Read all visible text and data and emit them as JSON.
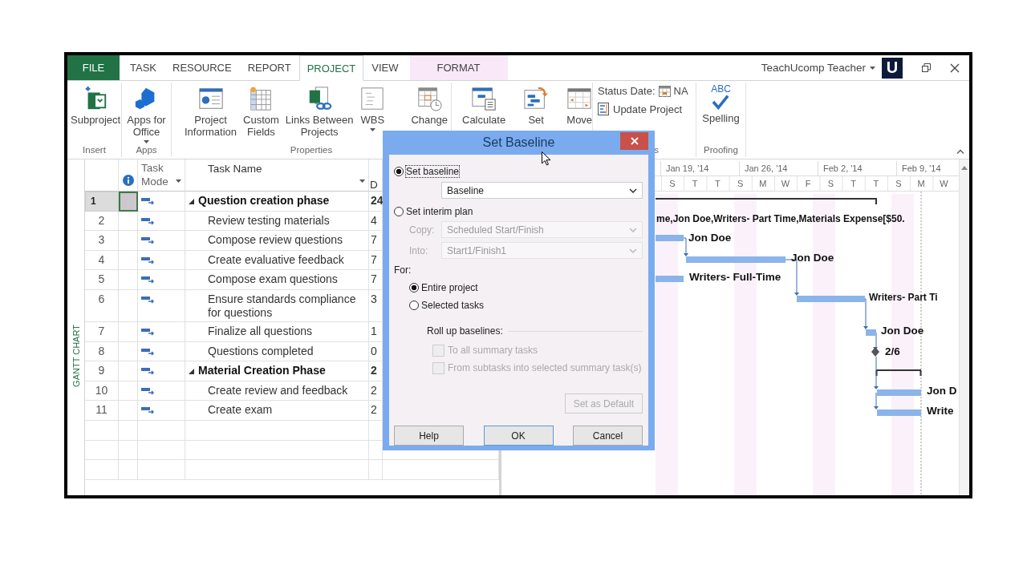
{
  "tabs": [
    {
      "label": "FILE",
      "kind": "file",
      "selected": false
    },
    {
      "label": "TASK",
      "kind": "normal",
      "selected": false
    },
    {
      "label": "RESOURCE",
      "kind": "normal",
      "selected": false
    },
    {
      "label": "REPORT",
      "kind": "normal",
      "selected": false
    },
    {
      "label": "PROJECT",
      "kind": "normal",
      "selected": true
    },
    {
      "label": "VIEW",
      "kind": "normal",
      "selected": false
    },
    {
      "label": "FORMAT",
      "kind": "contextual",
      "selected": false
    }
  ],
  "account": {
    "user": "TeachUcomp Teacher",
    "logo_letter": "U"
  },
  "ribbon": {
    "groups": [
      {
        "label": "Insert",
        "commands": [
          {
            "kind": "large",
            "lines": [
              "Subproject"
            ],
            "dropdown": false
          }
        ]
      },
      {
        "label": "Apps",
        "commands": [
          {
            "kind": "large",
            "lines": [
              "Apps for",
              "Office"
            ],
            "dropdown": true
          }
        ]
      },
      {
        "label": "Properties",
        "commands": [
          {
            "kind": "large",
            "lines": [
              "Project",
              "Information"
            ],
            "dropdown": false
          },
          {
            "kind": "large",
            "lines": [
              "Custom",
              "Fields"
            ],
            "dropdown": false
          },
          {
            "kind": "large",
            "lines": [
              "Links Between",
              "Projects"
            ],
            "dropdown": false
          },
          {
            "kind": "large",
            "lines": [
              "WBS"
            ],
            "dropdown": true
          },
          {
            "kind": "large",
            "lines": [
              "Change"
            ],
            "dropdown": false
          }
        ]
      },
      {
        "commands": [
          {
            "kind": "large",
            "lines": [
              "Calculate"
            ],
            "dropdown": false
          },
          {
            "kind": "large",
            "lines": [
              "Set"
            ],
            "dropdown": false
          },
          {
            "kind": "large",
            "lines": [
              "Move"
            ],
            "dropdown": false
          }
        ]
      },
      {
        "label": "s",
        "commands": [
          {
            "kind": "small",
            "label": "Status Date:",
            "value": "NA"
          },
          {
            "kind": "small",
            "label": "Update Project"
          }
        ]
      },
      {
        "label": "Proofing",
        "commands": [
          {
            "kind": "large",
            "badge": "ABC",
            "lines": [
              "Spelling"
            ],
            "dropdown": false
          }
        ]
      }
    ]
  },
  "view_label": "GANTT CHART",
  "columns": {
    "task_mode": [
      "Task",
      "Mode"
    ],
    "task_name": "Task Name",
    "column_5": "D"
  },
  "tasks": [
    {
      "id": "1",
      "name": "Question creation phase",
      "duration": "24",
      "selected": true,
      "expanded": true,
      "children": [
        {
          "id": "2",
          "name": "Review testing materials",
          "duration": "4",
          "selected": false
        },
        {
          "id": "3",
          "name": "Compose review questions",
          "duration": "7",
          "selected": false
        },
        {
          "id": "4",
          "name": "Create evaluative feedback",
          "duration": "7",
          "selected": false
        },
        {
          "id": "5",
          "name": "Compose exam questions",
          "duration": "7",
          "selected": false
        },
        {
          "id": "6",
          "name": "Ensure standards compliance for questions",
          "duration": "3",
          "selected": false
        },
        {
          "id": "7",
          "name": "Finalize all questions",
          "duration": "1",
          "selected": false
        },
        {
          "id": "8",
          "name": "Questions completed",
          "duration": "0",
          "selected": false
        }
      ]
    },
    {
      "id": "9",
      "name": "Material Creation Phase",
      "duration": "2",
      "selected": false,
      "expanded": true,
      "children": [
        {
          "id": "10",
          "name": "Create review and feedback",
          "duration": "2",
          "selected": false
        },
        {
          "id": "11",
          "name": "Create exam",
          "duration": "2",
          "selected": false
        }
      ]
    }
  ],
  "timescale": {
    "weeks": [
      "Jan 19, '14",
      "Jan 26, '14",
      "Feb 2, '14",
      "Feb 9, '14"
    ],
    "days": [
      "S",
      "T",
      "T",
      "S",
      "M",
      "W",
      "F",
      "S",
      "T",
      "T",
      "S",
      "M",
      "W"
    ]
  },
  "bar_labels": [
    "me,Jon Doe,Writers- Part Time,Materials Expense[$50.",
    "Jon Doe",
    "Jon Doe",
    "Writers- Full-Time",
    "Writers- Part Ti",
    "Jon Doe",
    "2/6",
    "Jon D",
    "Write"
  ],
  "dialog": {
    "title": "Set Baseline",
    "plan_options": [
      {
        "label": "Set baseline",
        "selected": true
      },
      {
        "label": "Set interim plan",
        "selected": false
      }
    ],
    "baseline_select": "Baseline",
    "copy": {
      "label": "Copy:",
      "value": "Scheduled Start/Finish",
      "disabled": true
    },
    "into": {
      "label": "Into:",
      "value": "Start1/Finish1",
      "disabled": true
    },
    "for_label": "For:",
    "scope_options": [
      {
        "label": "Entire project",
        "selected": true
      },
      {
        "label": "Selected tasks",
        "selected": false
      }
    ],
    "rollup_label": "Roll up baselines:",
    "rollup_options": [
      {
        "label": "To all summary tasks",
        "checked": false,
        "disabled": true
      },
      {
        "label": "From subtasks into selected summary task(s)",
        "checked": false,
        "disabled": true
      }
    ],
    "default_button": {
      "label": "Set as Default",
      "disabled": true
    },
    "buttons": [
      {
        "label": "Help",
        "default": false
      },
      {
        "label": "OK",
        "default": true
      },
      {
        "label": "Cancel",
        "default": false
      }
    ]
  }
}
